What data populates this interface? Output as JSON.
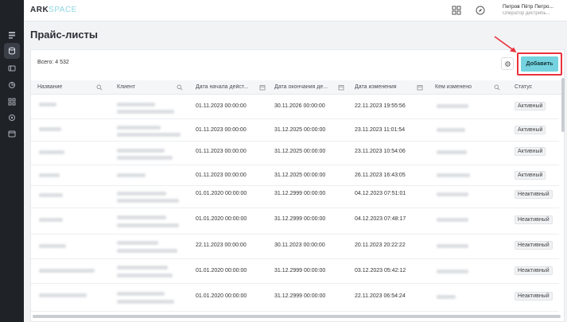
{
  "brand": {
    "part1": "ARK",
    "part2": "SPACE"
  },
  "user": {
    "name": "Петров Пётр Петро...",
    "role": "Оператор дистрибь..."
  },
  "page": {
    "title": "Прайс-листы",
    "total": "Всего: 4 532",
    "add_label": "Добавить"
  },
  "columns": [
    "Название",
    "Клиент",
    "Дата начала дейст...",
    "Дата окончания де...",
    "Дата изменения",
    "Кем изменено",
    "Статус"
  ],
  "rows": [
    {
      "start": "01.11.2023 00:00:00",
      "end": "30.11.2026 00:00:00",
      "changed": "22.11.2023 19:55:56",
      "status": "Активный"
    },
    {
      "start": "01.11.2023 00:00:00",
      "end": "31.12.2025 00:00:00",
      "changed": "23.11.2023 11:01:54",
      "status": "Активный"
    },
    {
      "start": "01.11.2023 00:00:00",
      "end": "31.12.2025 00:00:00",
      "changed": "23.11.2023 10:54:06",
      "status": "Активный"
    },
    {
      "start": "01.11.2023 00:00:00",
      "end": "31.12.2025 00:00:00",
      "changed": "26.11.2023 16:43:05",
      "status": "Активный"
    },
    {
      "start": "01.01.2020 00:00:00",
      "end": "31.12.2999 00:00:00",
      "changed": "04.12.2023 07:51:01",
      "status": "Неактивный"
    },
    {
      "start": "01.01.2020 00:00:00",
      "end": "31.12.2999 00:00:00",
      "changed": "04.12.2023 07:48:17",
      "status": "Неактивный"
    },
    {
      "start": "22.11.2023 00:00:00",
      "end": "30.11.2023 00:00:00",
      "changed": "20.11.2023 20:22:22",
      "status": "Неактивный"
    },
    {
      "start": "01.01.2020 00:00:00",
      "end": "31.12.2999 00:00:00",
      "changed": "03.12.2023 05:42:12",
      "status": "Неактивный"
    },
    {
      "start": "01.01.2020 00:00:00",
      "end": "31.12.2999 00:00:00",
      "changed": "22.11.2023 06:54:24",
      "status": "Неактивный"
    }
  ],
  "icons": {
    "sidebar": [
      "dashboard-icon",
      "database-icon",
      "card-icon",
      "chart-icon",
      "users-icon",
      "settings-icon",
      "calendar-icon"
    ],
    "topbar": [
      "grid-icon",
      "compass-icon",
      "chevron-down-icon"
    ]
  },
  "colors": {
    "accent": "#74d3df",
    "highlight": "#e8323c",
    "sidebar": "#1f2227"
  }
}
